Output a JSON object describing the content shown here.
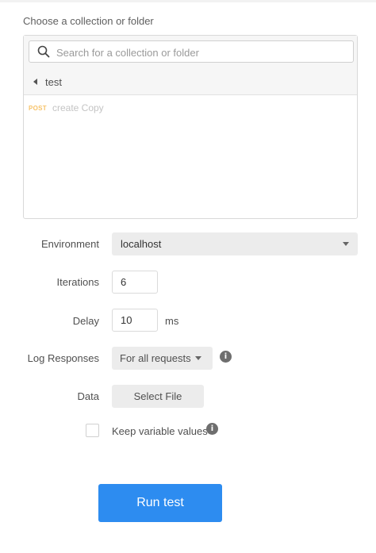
{
  "collection": {
    "label": "Choose a collection or folder",
    "search_placeholder": "Search for a collection or folder",
    "current_folder": "test",
    "requests": [
      {
        "method": "POST",
        "name": "create Copy"
      }
    ]
  },
  "form": {
    "environment_label": "Environment",
    "environment_value": "localhost",
    "iterations_label": "Iterations",
    "iterations_value": "6",
    "delay_label": "Delay",
    "delay_value": "10",
    "delay_unit": "ms",
    "log_responses_label": "Log Responses",
    "log_responses_value": "For all requests",
    "data_label": "Data",
    "select_file_label": "Select File",
    "keep_variable_label": "Keep variable values",
    "keep_variable_checked": false
  },
  "icons": {
    "search": "search-icon",
    "back": "caret-left-icon",
    "dropdown": "chevron-down-icon",
    "info": "info-icon"
  },
  "colors": {
    "accent": "#2d8cf0",
    "post_method": "#f7c36a"
  },
  "actions": {
    "run_label": "Run test"
  }
}
